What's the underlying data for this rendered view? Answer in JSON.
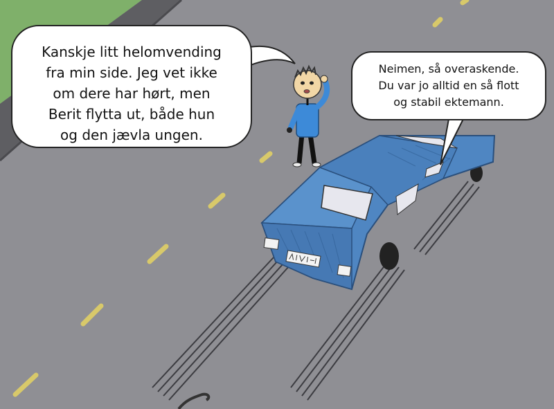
{
  "speech_left": {
    "lines": [
      "Kanskje litt helomvending",
      "fra min side. Jeg vet ikke",
      "om dere har hørt, men",
      "Berit flytta ut, både hun",
      "og den jævla ungen."
    ]
  },
  "speech_right": {
    "lines": [
      "Neimen, så overaskende.",
      "Du var jo alltid en så flott",
      "og stabil ektemann."
    ]
  },
  "colors": {
    "road": "#8f8f94",
    "grass": "#7fb06a",
    "curb": "#5e5e62",
    "lane_marking": "#d8c96a",
    "car_body": "#4f86c2",
    "car_dark": "#3b6ea5",
    "shirt": "#3d8ad8",
    "skin": "#f2d7a6"
  },
  "icons": {
    "plate": "license-plate-graphic"
  }
}
